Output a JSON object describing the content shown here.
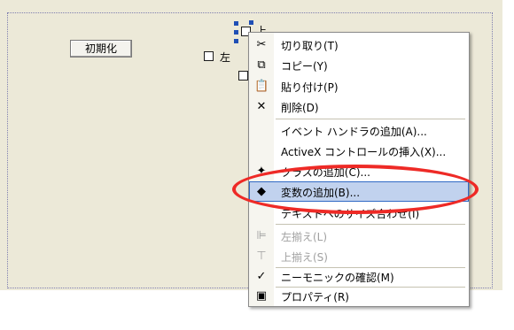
{
  "dialog": {
    "init_button_label": "初期化",
    "checkbox_left_label": "左",
    "checkbox_top_label_partial": "上"
  },
  "context_menu": {
    "cut": "切り取り(T)",
    "copy": "コピー(Y)",
    "paste": "貼り付け(P)",
    "delete": "削除(D)",
    "add_event_handler": "イベント ハンドラの追加(A)...",
    "insert_activex": "ActiveX コントロールの挿入(X)...",
    "add_class": "クラスの追加(C)...",
    "add_variable": "変数の追加(B)...",
    "size_to_content": "テキストへのサイズ合わせ(I)",
    "align_left": "左揃え(L)",
    "align_top": "上揃え(S)",
    "mnemonic_check": "ニーモニックの確認(M)",
    "properties": "プロパティ(R)"
  },
  "colors": {
    "dialog_bg": "#ece9d8",
    "highlight_bg": "#c1d2ee",
    "highlight_border": "#316ac5",
    "annotation_ellipse": "#ee2a26"
  },
  "icons": {
    "cut": "scissors-icon",
    "copy": "copy-icon",
    "paste": "paste-icon",
    "delete": "delete-x-icon",
    "add_class": "add-class-icon",
    "add_variable": "add-variable-icon",
    "align_left": "align-left-icon",
    "align_top": "align-top-icon",
    "mnemonic_check": "checkmark-icon",
    "properties": "properties-icon"
  }
}
